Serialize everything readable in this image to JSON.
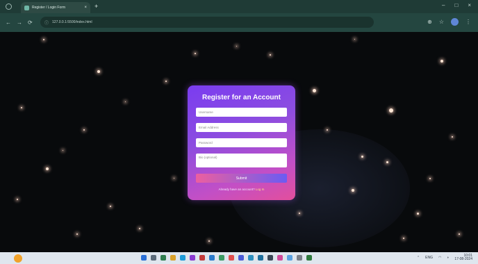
{
  "browser": {
    "tab_title": "Register / Login Form",
    "tab_close": "×",
    "tab_new": "+",
    "window_controls": [
      "–",
      "□",
      "×"
    ],
    "nav_icons": [
      "←",
      "→",
      "⟳"
    ],
    "address": "127.0.0.1:5500/index.html",
    "toolbar_icons": [
      "⊕",
      "☆",
      "⋮"
    ]
  },
  "form": {
    "title": "Register for an Account",
    "fields": {
      "username_placeholder": "Username",
      "email_placeholder": "Email Address",
      "password_placeholder": "Password",
      "bio_placeholder": "Bio (optional)"
    },
    "submit_label": "Submit",
    "login_prompt": "Already have an account?",
    "login_link": "Log In"
  },
  "colors": {
    "card_start": "#7a3cf0",
    "card_end": "#e34f9c",
    "button_start": "#ec5f9f",
    "button_end": "#6b5cf2"
  },
  "taskbar": {
    "tray_time": "10:01",
    "tray_date": "17-08-2024",
    "tray_lang": "ENG"
  }
}
